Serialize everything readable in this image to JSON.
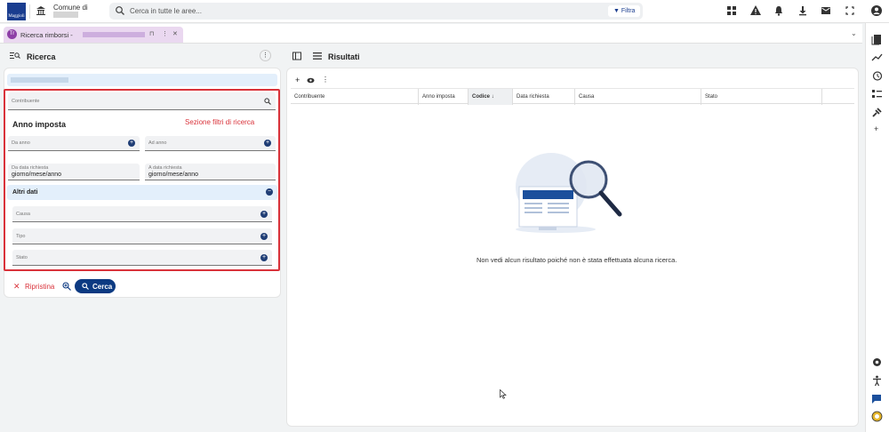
{
  "header": {
    "logo_text": "Maggioli",
    "comune_label": "Comune di",
    "search_placeholder": "Cerca in tutte le aree...",
    "filter_label": "Filtra",
    "icons": [
      "apps-icon",
      "warning-icon",
      "bell-icon",
      "download-icon",
      "mail-icon",
      "fullscreen-icon",
      "account-icon"
    ]
  },
  "tab": {
    "badge": "Tr",
    "label": "Ricerca rimborsi -"
  },
  "search_panel": {
    "title": "Ricerca",
    "contribuente_label": "Contribuente",
    "annotation": "Sezione filtri di ricerca",
    "anno_title": "Anno imposta",
    "da_anno": "Da anno",
    "ad_anno": "Ad anno",
    "da_data_label": "Da data richiesta",
    "a_data_label": "A data richiesta",
    "date_placeholder": "giorno/mese/anno",
    "altri_dati": "Altri dati",
    "causa": "Causa",
    "tipo": "Tipo",
    "stato": "Stato",
    "reset_label": "Ripristina",
    "search_label": "Cerca"
  },
  "results_panel": {
    "title": "Risultati",
    "columns": [
      "Contribuente",
      "Anno imposta",
      "Codice",
      "Data richiesta",
      "Causa",
      "Stato"
    ],
    "sorted_column_arrow": "↓",
    "empty_message": "Non vedi alcun risultato poiché non è stata effettuata alcuna ricerca."
  },
  "colors": {
    "accent": "#0c3a82",
    "highlight_red": "#d9323a",
    "tab_purple": "#8e3fa7"
  }
}
